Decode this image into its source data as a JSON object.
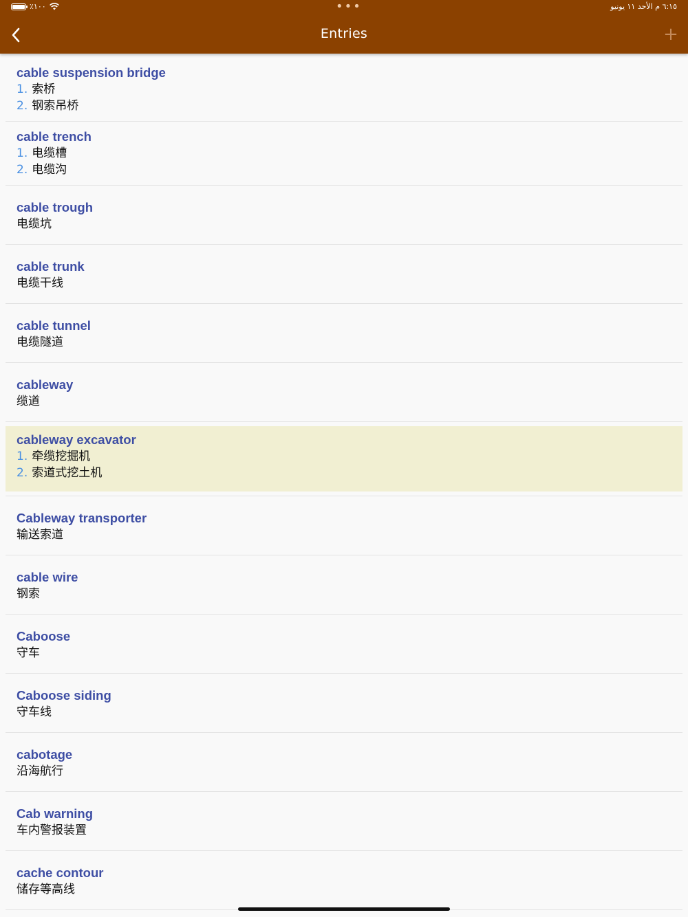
{
  "status_bar": {
    "battery_text": "٪١٠٠",
    "time_date": "٦:١٥ م  الأحد ١١ يونيو",
    "dots": "•••"
  },
  "nav": {
    "title": "Entries",
    "add_label": "+"
  },
  "entries": [
    {
      "term": "cable suspension bridge",
      "defs": [
        {
          "n": "1.",
          "t": "索桥"
        },
        {
          "n": "2.",
          "t": "钢索吊桥"
        }
      ]
    },
    {
      "term": "cable trench",
      "defs": [
        {
          "n": "1.",
          "t": "电缆槽"
        },
        {
          "n": "2.",
          "t": "电缆沟"
        }
      ]
    },
    {
      "term": "cable trough",
      "defs": [
        {
          "n": "",
          "t": "电缆坑"
        }
      ]
    },
    {
      "term": "cable trunk",
      "defs": [
        {
          "n": "",
          "t": "电缆干线"
        }
      ]
    },
    {
      "term": "cable tunnel",
      "defs": [
        {
          "n": "",
          "t": "电缆隧道"
        }
      ]
    },
    {
      "term": "cableway",
      "defs": [
        {
          "n": "",
          "t": "缆道"
        }
      ]
    },
    {
      "term": "cableway excavator",
      "selected": true,
      "defs": [
        {
          "n": "1.",
          "t": "牵缆挖掘机"
        },
        {
          "n": "2.",
          "t": "索道式挖土机"
        }
      ]
    },
    {
      "term": "Cableway transporter",
      "defs": [
        {
          "n": "",
          "t": "输送索道"
        }
      ]
    },
    {
      "term": "cable wire",
      "defs": [
        {
          "n": "",
          "t": "钢索"
        }
      ]
    },
    {
      "term": "Caboose",
      "defs": [
        {
          "n": "",
          "t": "守车"
        }
      ]
    },
    {
      "term": "Caboose siding",
      "defs": [
        {
          "n": "",
          "t": "守车线"
        }
      ]
    },
    {
      "term": "cabotage",
      "defs": [
        {
          "n": "",
          "t": "沿海航行"
        }
      ]
    },
    {
      "term": "Cab warning",
      "defs": [
        {
          "n": "",
          "t": "车内警报装置"
        }
      ]
    },
    {
      "term": "cache contour",
      "defs": [
        {
          "n": "",
          "t": "储存等高线"
        }
      ]
    }
  ]
}
